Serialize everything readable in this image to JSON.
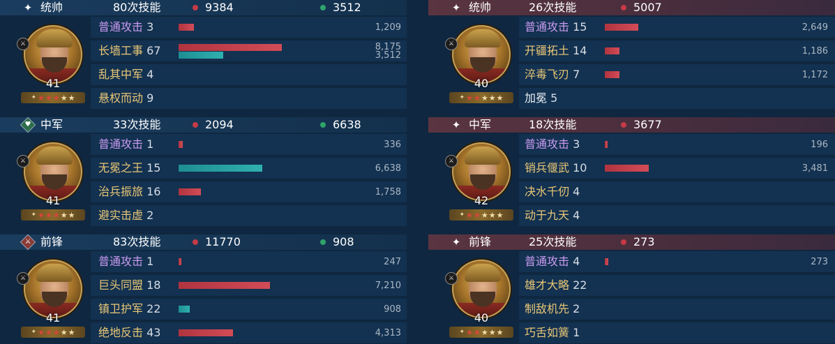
{
  "colors": {
    "damage": "#c63a47",
    "heal": "#2fa36b",
    "heal_bar": "#2fb0b0",
    "normal_skill": "#c99bf0",
    "skill": "#e9c877"
  },
  "teams": [
    {
      "side": "left",
      "sections": [
        {
          "role_icon": "four-point-star-icon",
          "role": "统帅",
          "skill_count": "80次技能",
          "damage": "9384",
          "heal": "3512",
          "level": "41",
          "stars_red": 3,
          "stars_total": 5,
          "rows": [
            {
              "name": "普通攻击",
              "count": "3",
              "type": "normal",
              "dmg_value": "1,209",
              "dmg_frac": 0.146,
              "heal_value": "",
              "heal_frac": 0
            },
            {
              "name": "长墙工事",
              "count": "67",
              "type": "skill",
              "dmg_value": "8,175",
              "dmg_frac": 1.0,
              "heal_value": "3,512",
              "heal_frac": 0.43
            },
            {
              "name": "乱其中军",
              "count": "4",
              "type": "skill",
              "dmg_value": "",
              "dmg_frac": 0,
              "heal_value": "",
              "heal_frac": 0
            },
            {
              "name": "悬权而动",
              "count": "9",
              "type": "skill",
              "dmg_value": "",
              "dmg_frac": 0,
              "heal_value": "",
              "heal_frac": 0
            }
          ]
        },
        {
          "role_icon": "heart-diamond-icon",
          "role": "中军",
          "skill_count": "33次技能",
          "damage": "2094",
          "heal": "6638",
          "level": "41",
          "stars_red": 3,
          "stars_total": 5,
          "rows": [
            {
              "name": "普通攻击",
              "count": "1",
              "type": "normal",
              "dmg_value": "336",
              "dmg_frac": 0.041,
              "heal_value": "",
              "heal_frac": 0
            },
            {
              "name": "无冕之王",
              "count": "15",
              "type": "skill",
              "dmg_value": "",
              "dmg_frac": 0,
              "heal_value": "6,638",
              "heal_frac": 0.812
            },
            {
              "name": "治兵振旅",
              "count": "16",
              "type": "skill",
              "dmg_value": "1,758",
              "dmg_frac": 0.215,
              "heal_value": "",
              "heal_frac": 0
            },
            {
              "name": "避实击虚",
              "count": "2",
              "type": "skill",
              "dmg_value": "",
              "dmg_frac": 0,
              "heal_value": "",
              "heal_frac": 0
            }
          ]
        },
        {
          "role_icon": "sword-diamond-icon",
          "role": "前锋",
          "skill_count": "83次技能",
          "damage": "11770",
          "heal": "908",
          "level": "41",
          "stars_red": 3,
          "stars_total": 5,
          "rows": [
            {
              "name": "普通攻击",
              "count": "1",
              "type": "normal",
              "dmg_value": "247",
              "dmg_frac": 0.03,
              "heal_value": "",
              "heal_frac": 0
            },
            {
              "name": "巨头同盟",
              "count": "18",
              "type": "skill",
              "dmg_value": "7,210",
              "dmg_frac": 0.882,
              "heal_value": "",
              "heal_frac": 0
            },
            {
              "name": "镇卫护军",
              "count": "22",
              "type": "skill",
              "dmg_value": "",
              "dmg_frac": 0,
              "heal_value": "908",
              "heal_frac": 0.111
            },
            {
              "name": "绝地反击",
              "count": "43",
              "type": "skill",
              "dmg_value": "4,313",
              "dmg_frac": 0.528,
              "heal_value": "",
              "heal_frac": 0
            }
          ]
        }
      ]
    },
    {
      "side": "right",
      "sections": [
        {
          "role_icon": "four-point-star-icon",
          "role": "统帅",
          "skill_count": "26次技能",
          "damage": "5007",
          "heal": "",
          "level": "40",
          "stars_red": 2,
          "stars_total": 5,
          "rows": [
            {
              "name": "普通攻击",
              "count": "15",
              "type": "normal",
              "dmg_value": "2,649",
              "dmg_frac": 0.324,
              "heal_value": "",
              "heal_frac": 0
            },
            {
              "name": "开疆拓土",
              "count": "14",
              "type": "skill",
              "dmg_value": "1,186",
              "dmg_frac": 0.145,
              "heal_value": "",
              "heal_frac": 0
            },
            {
              "name": "淬毒飞刃",
              "count": "7",
              "type": "skill",
              "dmg_value": "1,172",
              "dmg_frac": 0.143,
              "heal_value": "",
              "heal_frac": 0
            },
            {
              "name": "加冕",
              "count": "5",
              "type": "plain",
              "dmg_value": "",
              "dmg_frac": 0,
              "heal_value": "",
              "heal_frac": 0
            }
          ]
        },
        {
          "role_icon": "four-point-star-icon",
          "role": "中军",
          "skill_count": "18次技能",
          "damage": "3677",
          "heal": "",
          "level": "42",
          "stars_red": 2,
          "stars_total": 5,
          "rows": [
            {
              "name": "普通攻击",
              "count": "3",
              "type": "normal",
              "dmg_value": "196",
              "dmg_frac": 0.024,
              "heal_value": "",
              "heal_frac": 0
            },
            {
              "name": "销兵偃武",
              "count": "10",
              "type": "skill",
              "dmg_value": "3,481",
              "dmg_frac": 0.426,
              "heal_value": "",
              "heal_frac": 0
            },
            {
              "name": "决水千仞",
              "count": "4",
              "type": "skill",
              "dmg_value": "",
              "dmg_frac": 0,
              "heal_value": "",
              "heal_frac": 0
            },
            {
              "name": "动于九天",
              "count": "4",
              "type": "skill",
              "dmg_value": "",
              "dmg_frac": 0,
              "heal_value": "",
              "heal_frac": 0
            }
          ]
        },
        {
          "role_icon": "four-point-star-icon",
          "role": "前锋",
          "skill_count": "25次技能",
          "damage": "273",
          "heal": "",
          "level": "40",
          "stars_red": 2,
          "stars_total": 5,
          "rows": [
            {
              "name": "普通攻击",
              "count": "4",
              "type": "normal",
              "dmg_value": "273",
              "dmg_frac": 0.033,
              "heal_value": "",
              "heal_frac": 0
            },
            {
              "name": "雄才大略",
              "count": "22",
              "type": "skill",
              "dmg_value": "",
              "dmg_frac": 0,
              "heal_value": "",
              "heal_frac": 0
            },
            {
              "name": "制敌机先",
              "count": "2",
              "type": "skill",
              "dmg_value": "",
              "dmg_frac": 0,
              "heal_value": "",
              "heal_frac": 0
            },
            {
              "name": "巧舌如簧",
              "count": "1",
              "type": "skill",
              "dmg_value": "",
              "dmg_frac": 0,
              "heal_value": "",
              "heal_frac": 0
            }
          ]
        }
      ]
    }
  ]
}
